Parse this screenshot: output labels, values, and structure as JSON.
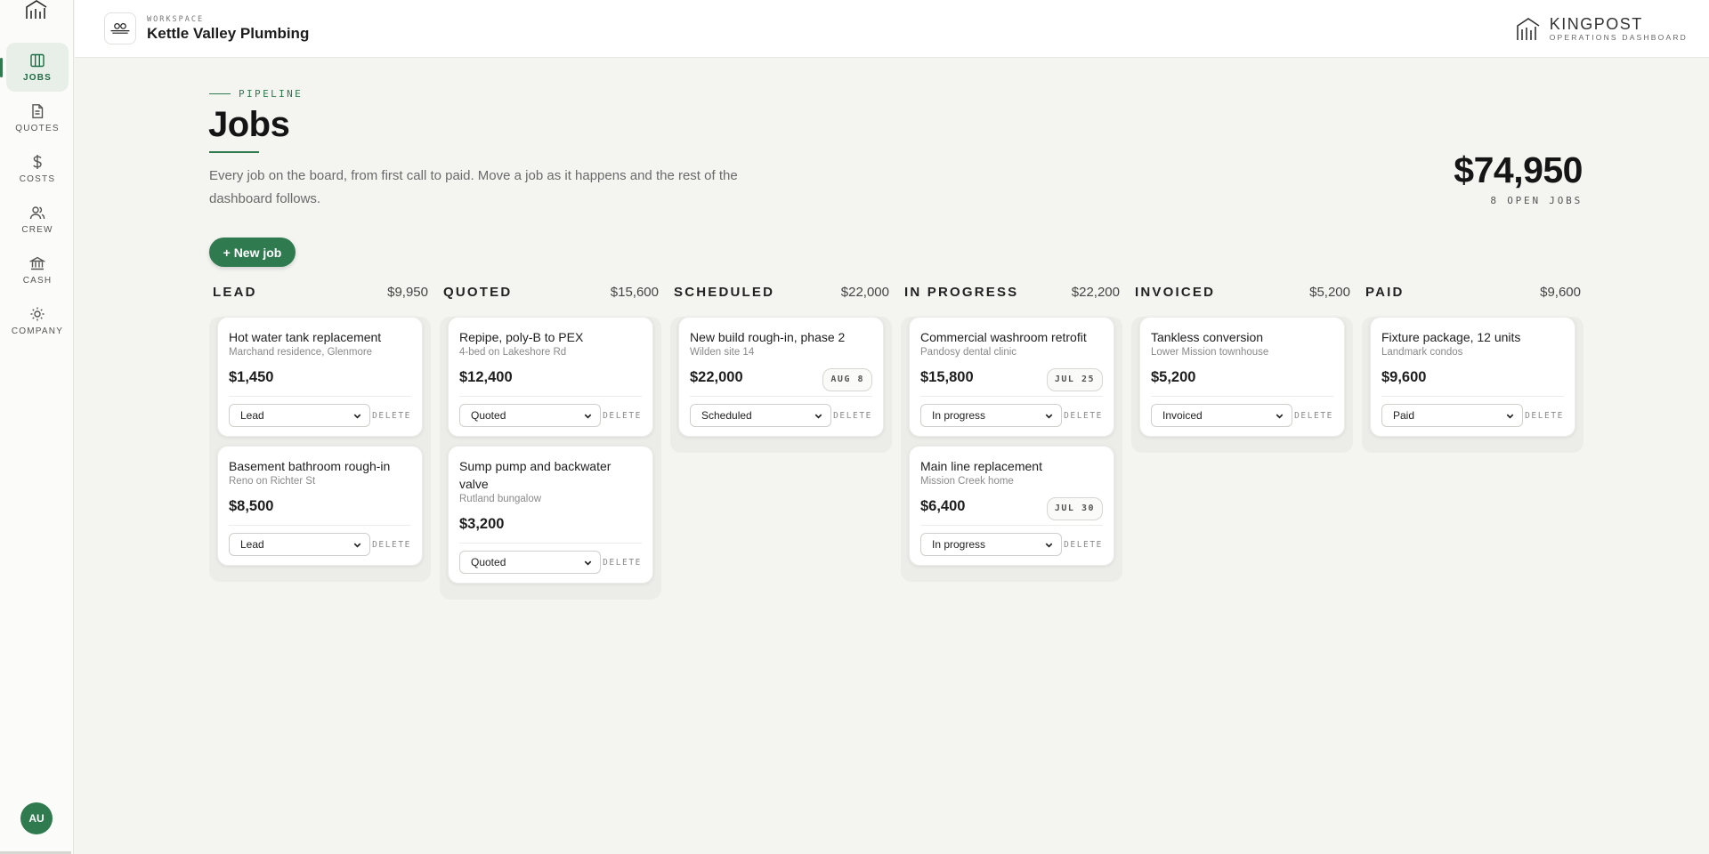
{
  "workspace": {
    "label": "WORKSPACE",
    "name": "Kettle Valley Plumbing"
  },
  "brand": {
    "name": "KINGPOST",
    "subtitle": "OPERATIONS DASHBOARD"
  },
  "sidebar": {
    "items": [
      {
        "label": "JOBS",
        "icon": "columns-icon",
        "active": true
      },
      {
        "label": "QUOTES",
        "icon": "document-icon"
      },
      {
        "label": "COSTS",
        "icon": "dollar-icon"
      },
      {
        "label": "CREW",
        "icon": "users-icon"
      },
      {
        "label": "CASH",
        "icon": "bank-icon"
      },
      {
        "label": "COMPANY",
        "icon": "sun-icon"
      }
    ],
    "avatar": "AU"
  },
  "page": {
    "eyebrow": "PIPELINE",
    "title": "Jobs",
    "description": "Every job on the board, from first call to paid. Move a job as it happens and the rest of the dashboard follows.",
    "total": "$74,950",
    "open_jobs": "8 OPEN JOBS",
    "new_job_label": "+ New job"
  },
  "colors": {
    "accent": "#2f7a4f",
    "background": "#f4f4f1"
  },
  "delete_label": "DELETE",
  "columns": [
    {
      "name": "LEAD",
      "total": "$9,950",
      "cards": [
        {
          "title": "Hot water tank replacement",
          "subtitle": "Marchand residence, Glenmore",
          "amount": "$1,450",
          "date": "",
          "status": "Lead"
        },
        {
          "title": "Basement bathroom rough-in",
          "subtitle": "Reno on Richter St",
          "amount": "$8,500",
          "date": "",
          "status": "Lead"
        }
      ]
    },
    {
      "name": "QUOTED",
      "total": "$15,600",
      "cards": [
        {
          "title": "Repipe, poly-B to PEX",
          "subtitle": "4-bed on Lakeshore Rd",
          "amount": "$12,400",
          "date": "",
          "status": "Quoted"
        },
        {
          "title": "Sump pump and backwater valve",
          "subtitle": "Rutland bungalow",
          "amount": "$3,200",
          "date": "",
          "status": "Quoted"
        }
      ]
    },
    {
      "name": "SCHEDULED",
      "total": "$22,000",
      "cards": [
        {
          "title": "New build rough-in, phase 2",
          "subtitle": "Wilden site 14",
          "amount": "$22,000",
          "date": "AUG 8",
          "status": "Scheduled"
        }
      ]
    },
    {
      "name": "IN PROGRESS",
      "total": "$22,200",
      "cards": [
        {
          "title": "Commercial washroom retrofit",
          "subtitle": "Pandosy dental clinic",
          "amount": "$15,800",
          "date": "JUL 25",
          "status": "In progress"
        },
        {
          "title": "Main line replacement",
          "subtitle": "Mission Creek home",
          "amount": "$6,400",
          "date": "JUL 30",
          "status": "In progress"
        }
      ]
    },
    {
      "name": "INVOICED",
      "total": "$5,200",
      "cards": [
        {
          "title": "Tankless conversion",
          "subtitle": "Lower Mission townhouse",
          "amount": "$5,200",
          "date": "",
          "status": "Invoiced"
        }
      ]
    },
    {
      "name": "PAID",
      "total": "$9,600",
      "cards": [
        {
          "title": "Fixture package, 12 units",
          "subtitle": "Landmark condos",
          "amount": "$9,600",
          "date": "",
          "status": "Paid"
        }
      ]
    }
  ]
}
